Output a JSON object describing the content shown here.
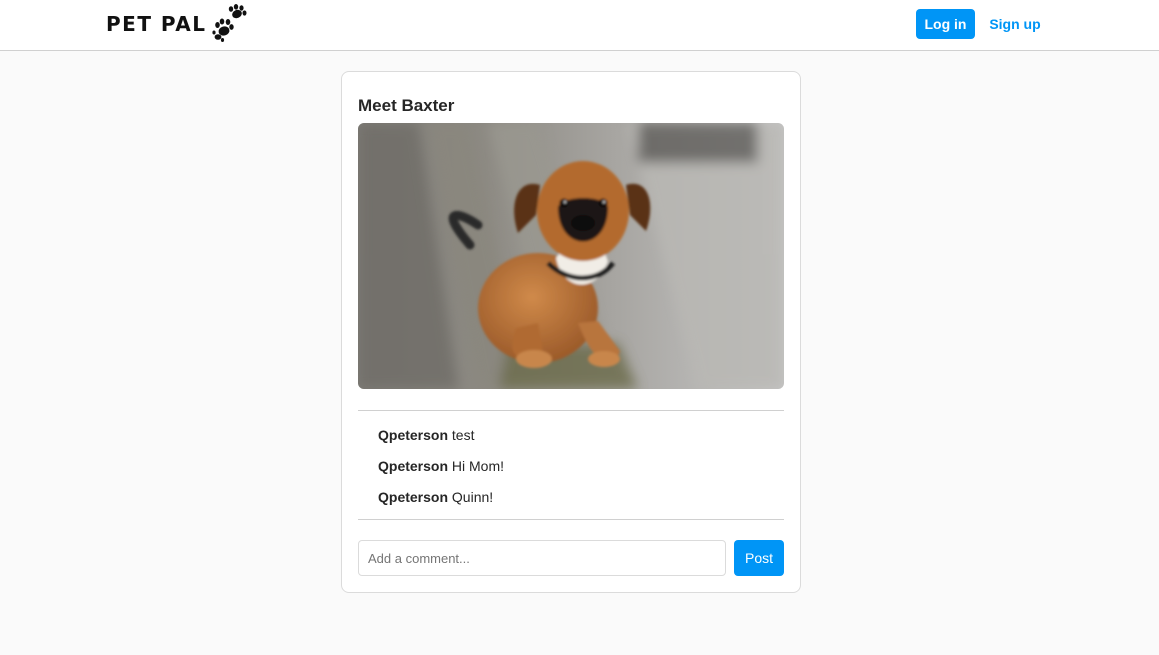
{
  "nav": {
    "logo_text": "PET PAL",
    "logo_icon": "paw-print-icon",
    "login_label": "Log in",
    "signup_label": "Sign up"
  },
  "post": {
    "title": "Meet Baxter",
    "image_subject": "brown boxer-mix puppy sitting on wooden boards",
    "comments": [
      {
        "user": "Qpeterson",
        "text": "test"
      },
      {
        "user": "Qpeterson",
        "text": "Hi Mom!"
      },
      {
        "user": "Qpeterson",
        "text": "Quinn!"
      }
    ],
    "comment_placeholder": "Add a comment...",
    "comment_value": "",
    "post_label": "Post"
  },
  "colors": {
    "accent": "#0095f6",
    "page_background": "#fafafa",
    "card_border": "#dbdbdb",
    "text": "#262626"
  }
}
